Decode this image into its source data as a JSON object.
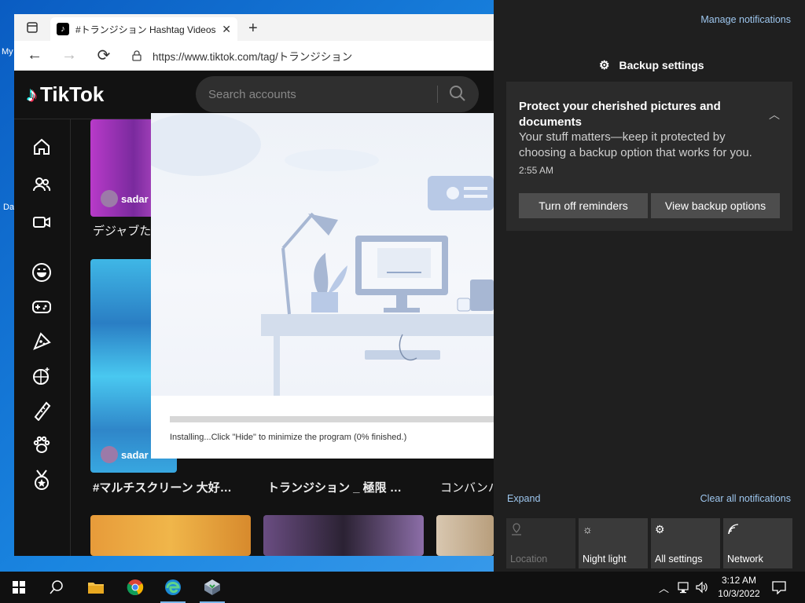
{
  "desktop": {
    "icon_label_1": "My",
    "icon_label_2": "Da"
  },
  "browser": {
    "tab_title": "#トランジション Hashtag Videos on",
    "tab_close": "✕",
    "new_tab": "+",
    "url": "https://www.tiktok.com/tag/トランジション"
  },
  "tiktok": {
    "logo": "TikTok",
    "search_placeholder": "Search accounts",
    "username_1": "sadar",
    "username_2": "sadar",
    "caption_1": "デジャブた",
    "caption_2": "#マルチスクリーン 大好…",
    "caption_3": "トランジション _ 極限 …",
    "caption_4": "コンバンハ"
  },
  "installer": {
    "status": "Installing...Click \"Hide\" to minimize the program (0% finished.)",
    "progress_percent": 0
  },
  "action_center": {
    "manage": "Manage notifications",
    "app_name": "Backup settings",
    "title": "Protect your cherished pictures and documents",
    "body": "Your stuff matters—keep it protected by choosing a backup option that works for you.",
    "time": "2:55 AM",
    "btn_reminders": "Turn off reminders",
    "btn_backup": "View backup options",
    "expand": "Expand",
    "clear_all": "Clear all notifications",
    "tiles": [
      {
        "label": "Location"
      },
      {
        "label": "Night light"
      },
      {
        "label": "All settings"
      },
      {
        "label": "Network"
      }
    ]
  },
  "taskbar": {
    "time": "3:12 AM",
    "date": "10/3/2022"
  }
}
